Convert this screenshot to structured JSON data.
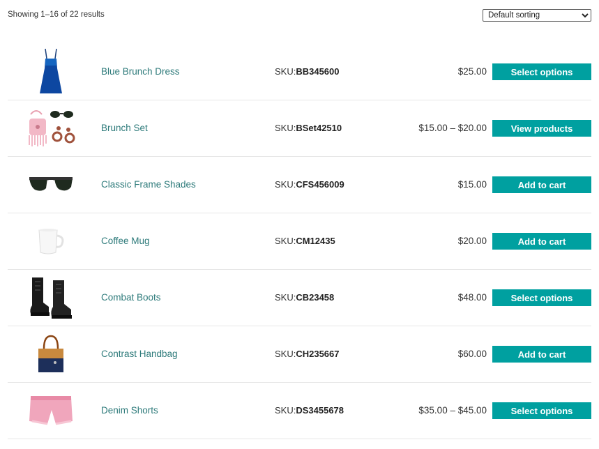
{
  "result_count": "Showing 1–16 of 22 results",
  "sorting": {
    "selected": "Default sorting",
    "options": [
      "Default sorting"
    ]
  },
  "colors": {
    "accent": "#00a0a0",
    "link": "#2d7a7a"
  },
  "sku_label": "SKU:",
  "products": [
    {
      "name": "Blue Brunch Dress",
      "sku": "BB345600",
      "price": "$25.00",
      "action": "Select options",
      "icon": "dress-icon"
    },
    {
      "name": "Brunch Set",
      "sku": "BSet42510",
      "price": "$15.00 – $20.00",
      "action": "View products",
      "icon": "brunch-set-icon"
    },
    {
      "name": "Classic Frame Shades",
      "sku": "CFS456009",
      "price": "$15.00",
      "action": "Add to cart",
      "icon": "sunglasses-icon"
    },
    {
      "name": "Coffee Mug",
      "sku": "CM12435",
      "price": "$20.00",
      "action": "Add to cart",
      "icon": "mug-icon"
    },
    {
      "name": "Combat Boots",
      "sku": "CB23458",
      "price": "$48.00",
      "action": "Select options",
      "icon": "boots-icon"
    },
    {
      "name": "Contrast Handbag",
      "sku": "CH235667",
      "price": "$60.00",
      "action": "Add to cart",
      "icon": "handbag-icon"
    },
    {
      "name": "Denim Shorts",
      "sku": "DS3455678",
      "price": "$35.00 – $45.00",
      "action": "Select options",
      "icon": "shorts-icon"
    }
  ]
}
